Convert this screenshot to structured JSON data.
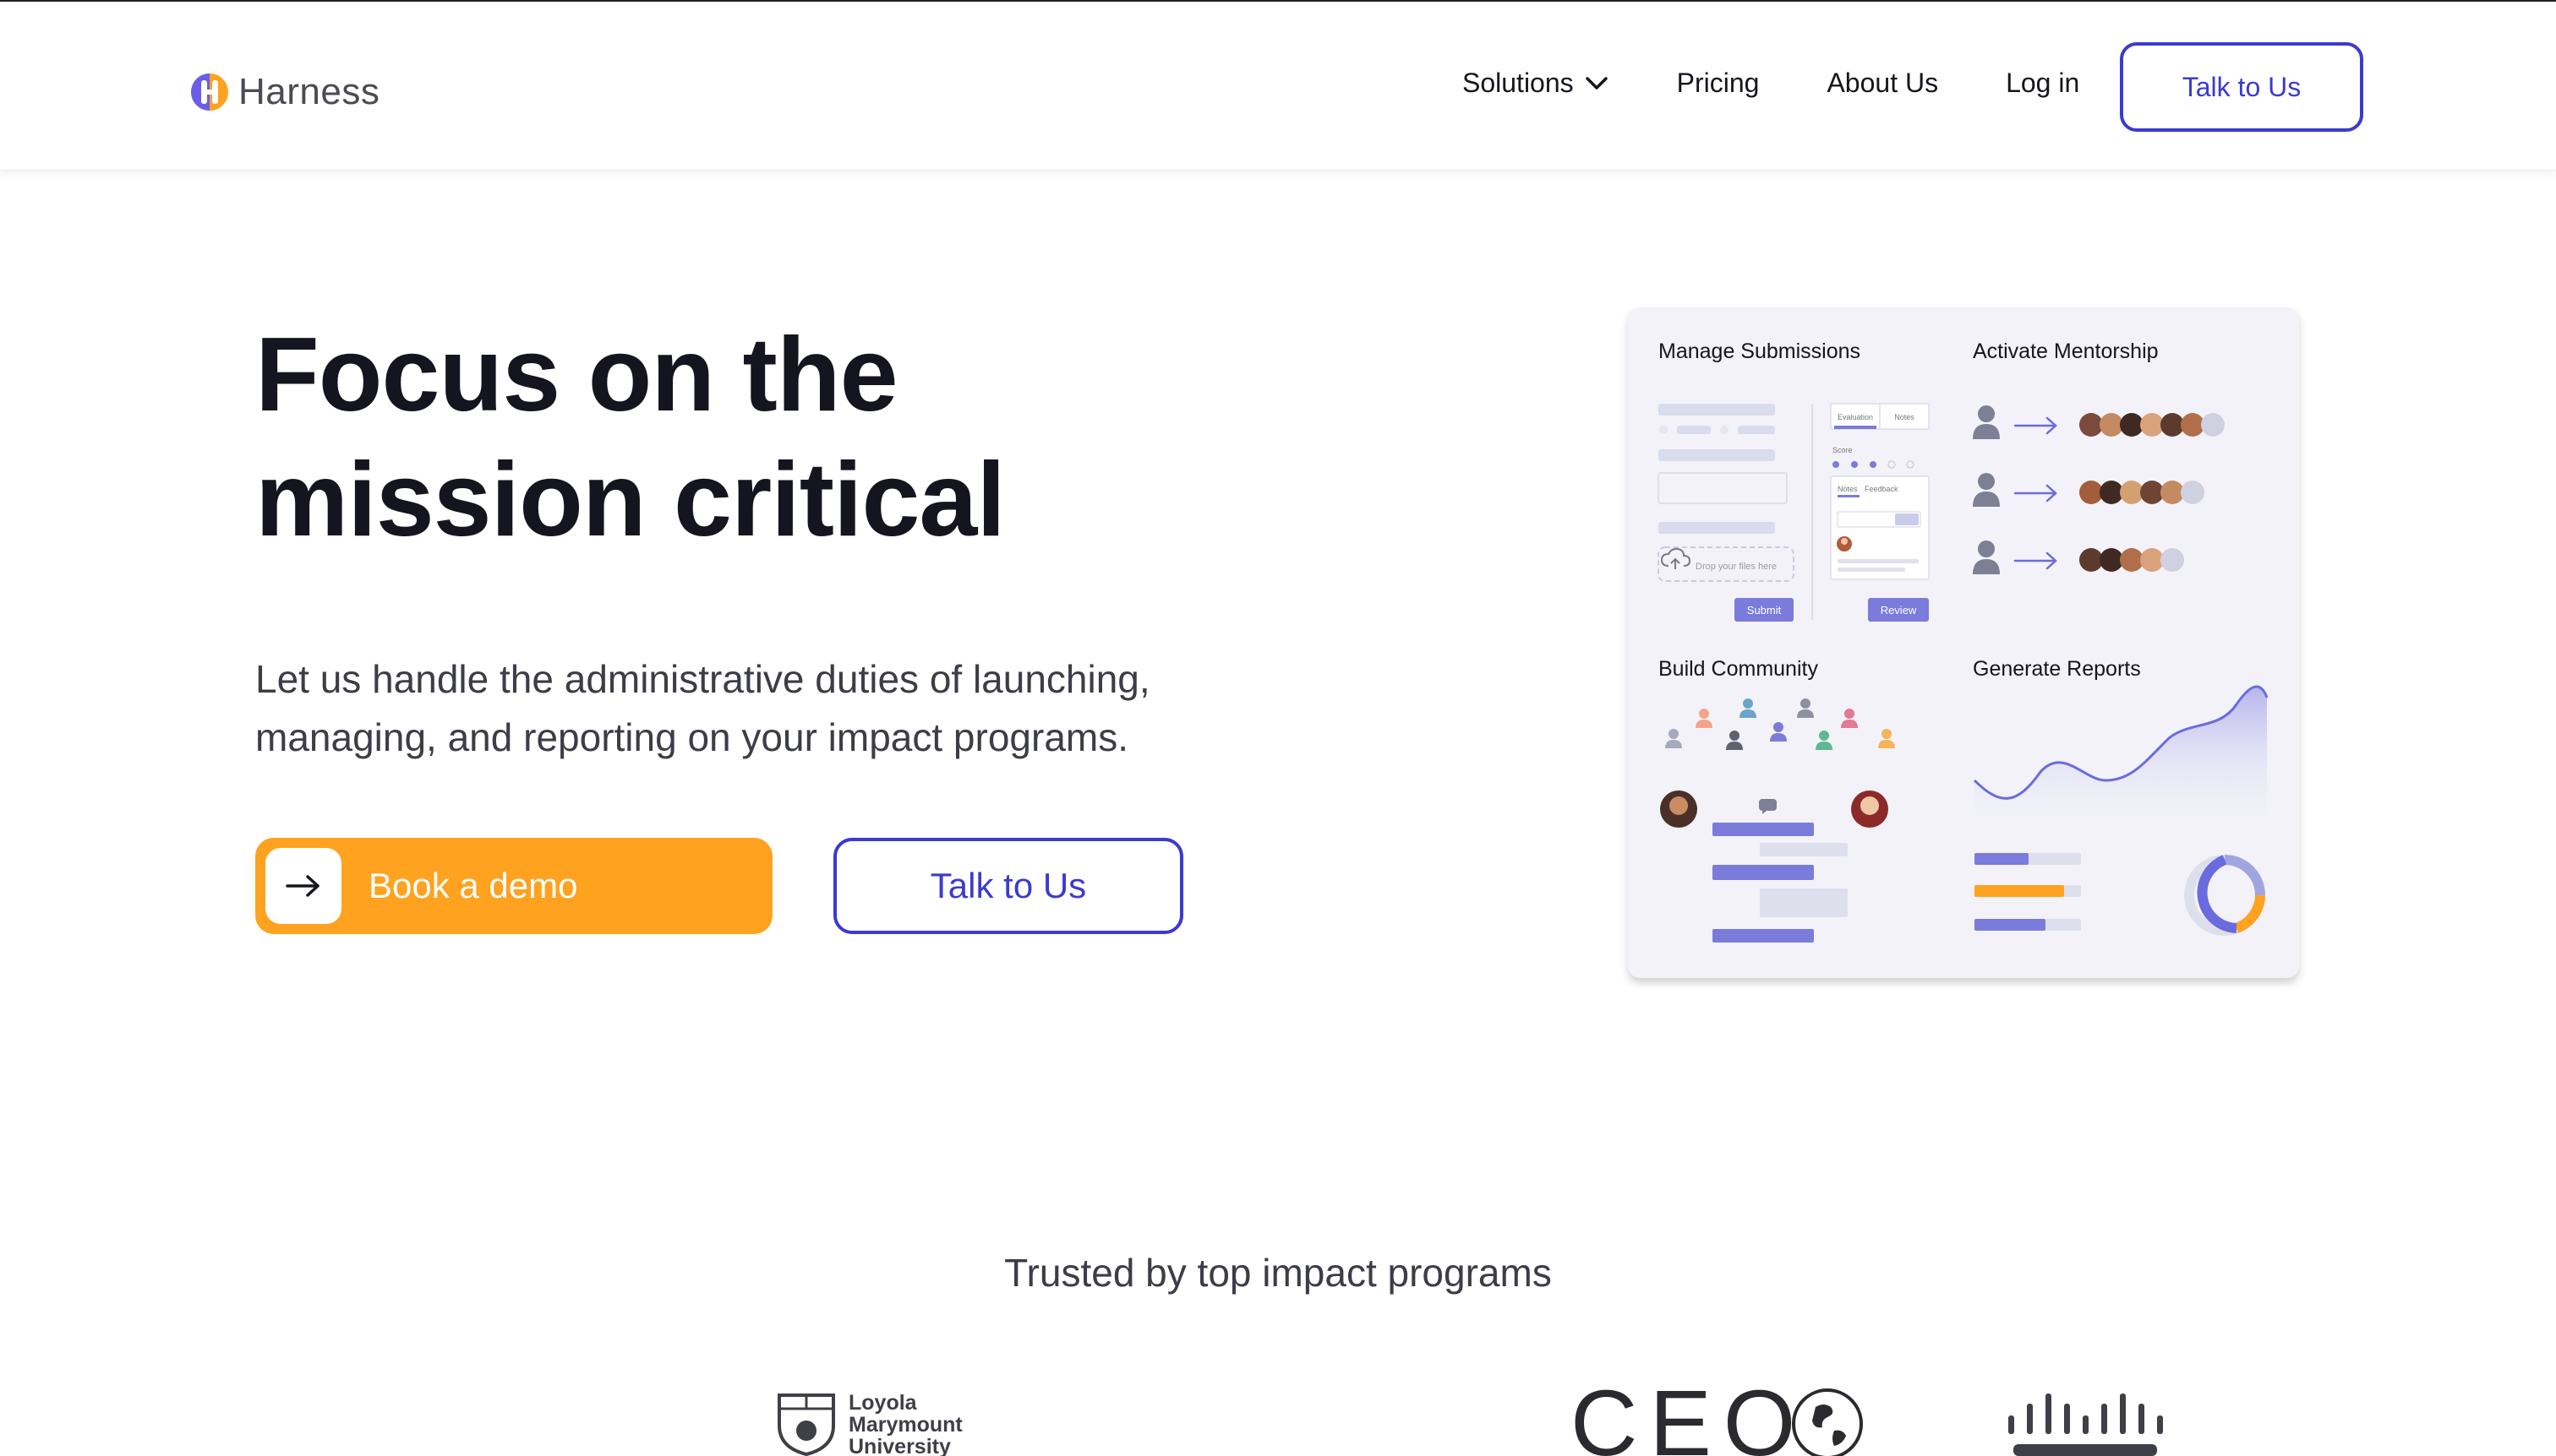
{
  "brand": {
    "name": "Harness",
    "colors": {
      "primary": "#3b3ad1",
      "accent": "#ffa21f",
      "text": "#15151f"
    }
  },
  "nav": {
    "links": [
      {
        "label": "Solutions",
        "has_dropdown": true
      },
      {
        "label": "Pricing"
      },
      {
        "label": "About Us"
      },
      {
        "label": "Log in"
      }
    ],
    "cta_label": "Talk to Us"
  },
  "hero": {
    "title_line1": "Focus on the",
    "title_line2": "mission critical",
    "subtitle": "Let us handle the administrative duties of launching, managing, and reporting on your impact programs.",
    "primary_button": "Book a demo",
    "secondary_button": "Talk to Us"
  },
  "illustration": {
    "panels": [
      {
        "title": "Manage Submissions"
      },
      {
        "title": "Activate Mentorship"
      },
      {
        "title": "Build Community"
      },
      {
        "title": "Generate Reports"
      }
    ],
    "submissions": {
      "tab_evaluation": "Evaluation",
      "tab_notes": "Notes",
      "score_label": "Score",
      "notes_label": "Notes",
      "feedback_label": "Feedback",
      "dropzone_text": "Drop your files here",
      "submit_label": "Submit",
      "review_label": "Review"
    }
  },
  "trusted": {
    "heading": "Trusted by top impact programs",
    "logos": [
      {
        "name": "Loyola Marymount University",
        "line1": "Loyola",
        "line2": "Marymount",
        "line3": "University"
      },
      {
        "name": "CEO",
        "text": "CEO"
      },
      {
        "name": "Cisco"
      }
    ]
  }
}
